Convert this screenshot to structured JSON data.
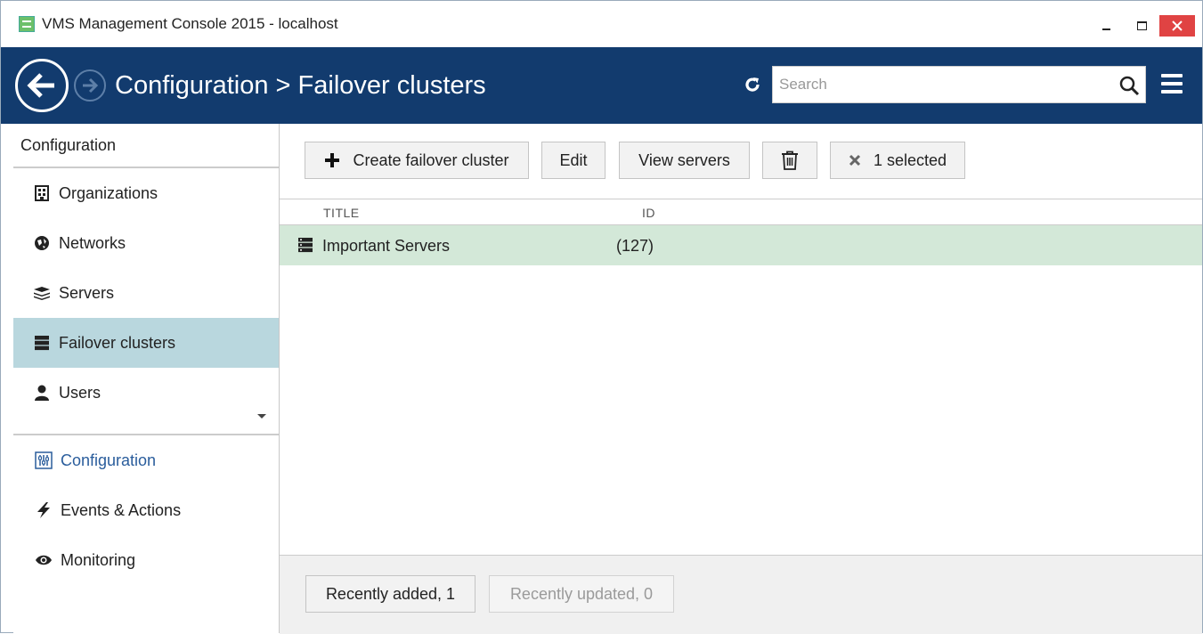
{
  "window": {
    "title": "VMS Management Console 2015 - localhost",
    "icons": [
      "app-icon",
      "minimize-icon",
      "maximize-icon",
      "close-icon"
    ]
  },
  "header": {
    "breadcrumb": "Configuration > Failover clusters",
    "search_placeholder": "Search",
    "icons": [
      "back-arrow-icon",
      "forward-arrow-icon",
      "refresh-icon",
      "search-icon",
      "hamburger-menu-icon"
    ],
    "background_color": "#123b6e"
  },
  "sidebar": {
    "title": "Configuration",
    "items": [
      {
        "label": "Organizations",
        "icon": "building-icon"
      },
      {
        "label": "Networks",
        "icon": "network-icon"
      },
      {
        "label": "Servers",
        "icon": "servers-icon"
      },
      {
        "label": "Failover clusters",
        "icon": "failover-cluster-icon",
        "selected": true
      },
      {
        "label": "Users",
        "icon": "user-icon"
      }
    ],
    "bottom_nav": [
      {
        "label": "Configuration",
        "icon": "configuration-icon",
        "active": true
      },
      {
        "label": "Events & Actions",
        "icon": "lightning-icon"
      },
      {
        "label": "Monitoring",
        "icon": "eye-icon"
      }
    ],
    "selected_color": "#b9d7de"
  },
  "toolbar": {
    "create_label": "Create failover cluster",
    "edit_label": "Edit",
    "view_servers_label": "View servers",
    "selected_label": "1 selected",
    "icons": [
      "plus-icon",
      "trash-icon",
      "deselect-x-icon"
    ]
  },
  "list": {
    "columns": [
      "TITLE",
      "ID"
    ],
    "rows": [
      {
        "title": "Important Servers",
        "id": "(127)",
        "icon": "failover-cluster-icon",
        "selected": true
      }
    ],
    "selected_row_color": "#d3e8d8"
  },
  "footer": {
    "recently_added": "Recently added, 1",
    "recently_updated": "Recently updated, 0"
  }
}
